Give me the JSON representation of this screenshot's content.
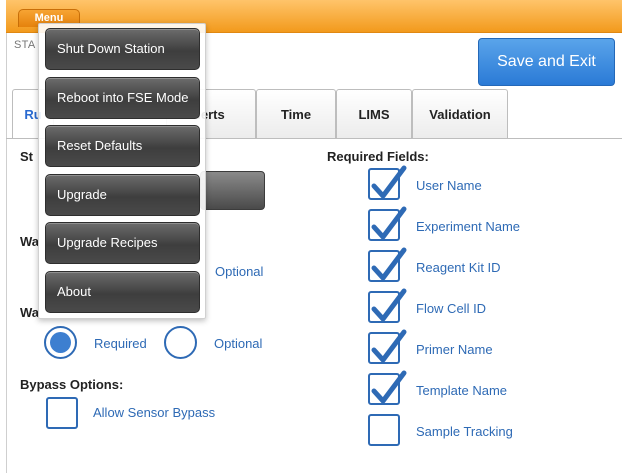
{
  "topbar": {
    "menu_label": "Menu"
  },
  "station_label": "STA",
  "save_button_label": "Save and Exit",
  "tabs": [
    {
      "label": "Ru",
      "active": true
    },
    {
      "label": "lerts"
    },
    {
      "label": "Time"
    },
    {
      "label": "LIMS"
    },
    {
      "label": "Validation"
    }
  ],
  "left": {
    "section1_label": "St",
    "section2_label": "Wa",
    "section2_optional": "Optional",
    "section3_label": "Wa",
    "section3_required": "Required",
    "section3_optional": "Optional",
    "section3_selected": "Required",
    "bypass_title": "Bypass Options:",
    "bypass_label": "Allow Sensor Bypass",
    "bypass_checked": false
  },
  "required_fields": {
    "title": "Required Fields:",
    "items": [
      {
        "label": "User Name",
        "checked": true
      },
      {
        "label": "Experiment Name",
        "checked": true
      },
      {
        "label": "Reagent Kit ID",
        "checked": true
      },
      {
        "label": "Flow Cell ID",
        "checked": true
      },
      {
        "label": "Primer Name",
        "checked": true
      },
      {
        "label": "Template Name",
        "checked": true
      },
      {
        "label": "Sample Tracking",
        "checked": false
      }
    ]
  },
  "menu": {
    "items": [
      {
        "label": "Shut Down Station"
      },
      {
        "label": "Reboot into FSE Mode"
      },
      {
        "label": "Reset Defaults"
      },
      {
        "label": "Upgrade"
      },
      {
        "label": "Upgrade Recipes"
      },
      {
        "label": "About"
      }
    ]
  },
  "colors": {
    "accent_orange": "#f29a1c",
    "save_blue": "#2a7ad6",
    "control_blue": "#2e6ab5"
  }
}
